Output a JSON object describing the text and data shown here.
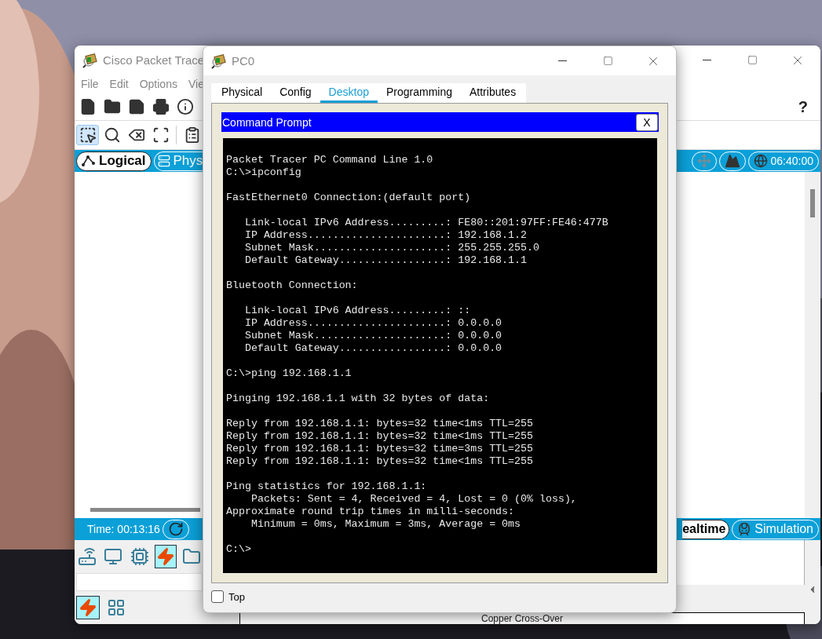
{
  "main_window": {
    "title": "Cisco Packet Trace",
    "menu": [
      "File",
      "Edit",
      "Options",
      "Vie"
    ],
    "file_tools": [
      {
        "kind": "new"
      },
      {
        "kind": "open"
      },
      {
        "kind": "save"
      },
      {
        "kind": "print"
      },
      {
        "kind": "info"
      }
    ],
    "help": "?",
    "edit_tools": [
      {
        "kind": "select",
        "selected": true
      },
      {
        "kind": "inspect",
        "selected": false
      },
      {
        "kind": "delete",
        "selected": false
      },
      {
        "kind": "resize",
        "selected": false
      },
      {
        "kind": "note",
        "selected": false
      }
    ],
    "workspace_tabs": [
      {
        "label": "Logical",
        "selected": true
      },
      {
        "label": "Phys",
        "selected": false
      }
    ],
    "clock": "06:40:00",
    "sim_time": "Time: 00:13:16",
    "mode_tabs": [
      {
        "label": "ealtime",
        "selected": true
      },
      {
        "label": "Simulation",
        "selected": false
      }
    ],
    "device_types": [
      {
        "kind": "network",
        "selected": false
      },
      {
        "kind": "end-device",
        "selected": false
      },
      {
        "kind": "component",
        "selected": false
      },
      {
        "kind": "connection",
        "selected": true
      },
      {
        "kind": "misc",
        "selected": false
      }
    ],
    "connection_types": [
      {
        "kind": "auto",
        "selected": true
      },
      {
        "kind": "grid",
        "selected": false
      }
    ],
    "cable_label": "Copper Cross-Over"
  },
  "pc_window": {
    "title": "PC0",
    "tabs": [
      {
        "label": "Physical",
        "selected": false
      },
      {
        "label": "Config",
        "selected": false
      },
      {
        "label": "Desktop",
        "selected": true
      },
      {
        "label": "Programming",
        "selected": false
      },
      {
        "label": "Attributes",
        "selected": false
      }
    ],
    "app_title": "Command Prompt",
    "app_close": "X",
    "terminal": [
      [
        "Packet Tracer PC Command Line 1.0",
        "C:\\>ipconfig"
      ],
      [
        "FastEthernet0 Connection:(default port)"
      ],
      [
        "   Link-local IPv6 Address.........: FE80::201:97FF:FE46:477B",
        "   IP Address......................: 192.168.1.2",
        "   Subnet Mask.....................: 255.255.255.0",
        "   Default Gateway.................: 192.168.1.1"
      ],
      [
        "Bluetooth Connection:"
      ],
      [
        "   Link-local IPv6 Address.........: ::",
        "   IP Address......................: 0.0.0.0",
        "   Subnet Mask.....................: 0.0.0.0",
        "   Default Gateway.................: 0.0.0.0"
      ],
      [
        "C:\\>ping 192.168.1.1"
      ],
      [
        "Pinging 192.168.1.1 with 32 bytes of data:"
      ],
      [
        "Reply from 192.168.1.1: bytes=32 time<1ms TTL=255",
        "Reply from 192.168.1.1: bytes=32 time<1ms TTL=255",
        "Reply from 192.168.1.1: bytes=32 time=3ms TTL=255",
        "Reply from 192.168.1.1: bytes=32 time<1ms TTL=255"
      ],
      [
        "Ping statistics for 192.168.1.1:",
        "    Packets: Sent = 4, Received = 4, Lost = 0 (0% loss),",
        "Approximate round trip times in milli-seconds:",
        "    Minimum = 0ms, Maximum = 3ms, Average = 0ms"
      ],
      [
        "C:\\>"
      ]
    ],
    "top_checkbox": {
      "label": "Top",
      "checked": false
    }
  }
}
